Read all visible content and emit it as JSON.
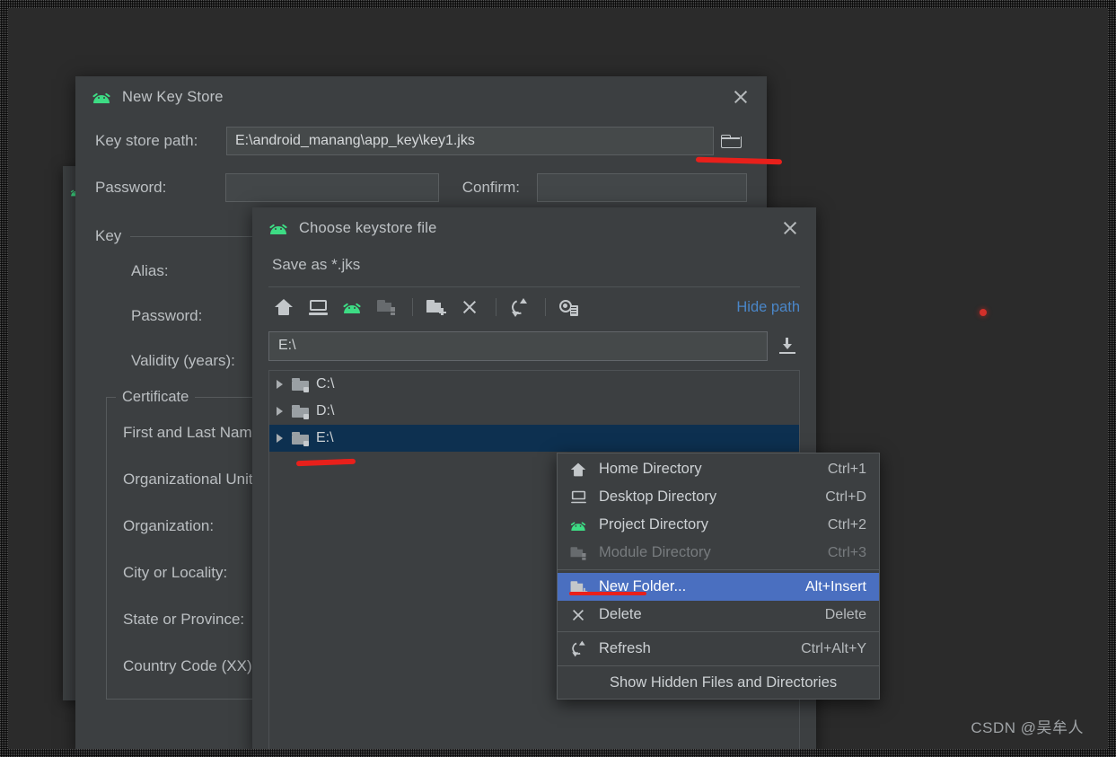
{
  "new_key_store": {
    "title": "New Key Store",
    "icon": "android-icon",
    "close_label": "✕",
    "key_store_path_label": "Key store path:",
    "key_store_path_value": "E:\\android_manang\\app_key\\key1.jks",
    "browse_icon": "folder-open-icon",
    "password_label": "Password:",
    "password_value": "",
    "confirm_label": "Confirm:",
    "confirm_value": "",
    "key_section_label": "Key",
    "key_fields": [
      {
        "label": "Alias:"
      },
      {
        "label": "Password:"
      },
      {
        "label": "Validity (years):"
      }
    ],
    "certificate_legend": "Certificate",
    "certificate_fields": [
      {
        "label": "First and Last Name:"
      },
      {
        "label": "Organizational Unit:"
      },
      {
        "label": "Organization:"
      },
      {
        "label": "City or Locality:"
      },
      {
        "label": "State or Province:"
      },
      {
        "label": "Country Code (XX):"
      }
    ]
  },
  "choose_keystore": {
    "title": "Choose keystore file",
    "icon": "android-icon",
    "close_label": "✕",
    "subtitle": "Save as *.jks",
    "toolbar": [
      {
        "name": "home-directory-button",
        "icon": "home-icon",
        "enabled": true
      },
      {
        "name": "desktop-directory-button",
        "icon": "monitor-icon",
        "enabled": true
      },
      {
        "name": "project-directory-button",
        "icon": "android-icon",
        "enabled": true
      },
      {
        "name": "module-directory-button",
        "icon": "module-folder-icon",
        "enabled": false
      },
      {
        "name": "new-folder-button",
        "icon": "new-folder-icon",
        "enabled": true
      },
      {
        "name": "delete-button",
        "icon": "close-x-icon",
        "enabled": true
      },
      {
        "name": "refresh-button",
        "icon": "refresh-icon",
        "enabled": true
      },
      {
        "name": "show-hidden-button",
        "icon": "hidden-files-icon",
        "enabled": true
      }
    ],
    "hide_path_label": "Hide path",
    "path_value": "E:\\",
    "path_dropdown_icon": "download-icon",
    "tree": [
      {
        "label": "C:\\",
        "selected": false,
        "icon": "folder-icon"
      },
      {
        "label": "D:\\",
        "selected": false,
        "icon": "folder-icon"
      },
      {
        "label": "E:\\",
        "selected": true,
        "icon": "folder-icon"
      }
    ]
  },
  "context_menu": {
    "items": [
      {
        "label": "Home Directory",
        "shortcut": "Ctrl+1",
        "icon": "home-icon",
        "state": "normal"
      },
      {
        "label": "Desktop Directory",
        "shortcut": "Ctrl+D",
        "icon": "monitor-icon",
        "state": "normal"
      },
      {
        "label": "Project Directory",
        "shortcut": "Ctrl+2",
        "icon": "android-icon",
        "state": "normal"
      },
      {
        "label": "Module Directory",
        "shortcut": "Ctrl+3",
        "icon": "module-folder-icon",
        "state": "disabled"
      },
      {
        "label": "New Folder...",
        "shortcut": "Alt+Insert",
        "icon": "new-folder-icon",
        "state": "highlight"
      },
      {
        "label": "Delete",
        "shortcut": "Delete",
        "icon": "close-x-icon",
        "state": "normal"
      },
      {
        "label": "Refresh",
        "shortcut": "Ctrl+Alt+Y",
        "icon": "refresh-icon",
        "state": "normal"
      },
      {
        "label": "Show Hidden Files and Directories",
        "shortcut": "",
        "icon": "",
        "state": "noicon"
      }
    ]
  },
  "annotations": {
    "marks": [
      "red-underline-browse-button",
      "red-underline-e-drive",
      "red-underline-new-folder",
      "red-dot"
    ],
    "color": "#e8201b"
  },
  "watermark": "CSDN @吴牟人",
  "colors": {
    "window_bg": "#3c3f41",
    "desktop_bg": "#2b2b2b",
    "selection_blue": "#0d3050",
    "menu_highlight": "#4a6fc0",
    "link_blue": "#4a86c8",
    "android_green": "#3ddc84"
  }
}
